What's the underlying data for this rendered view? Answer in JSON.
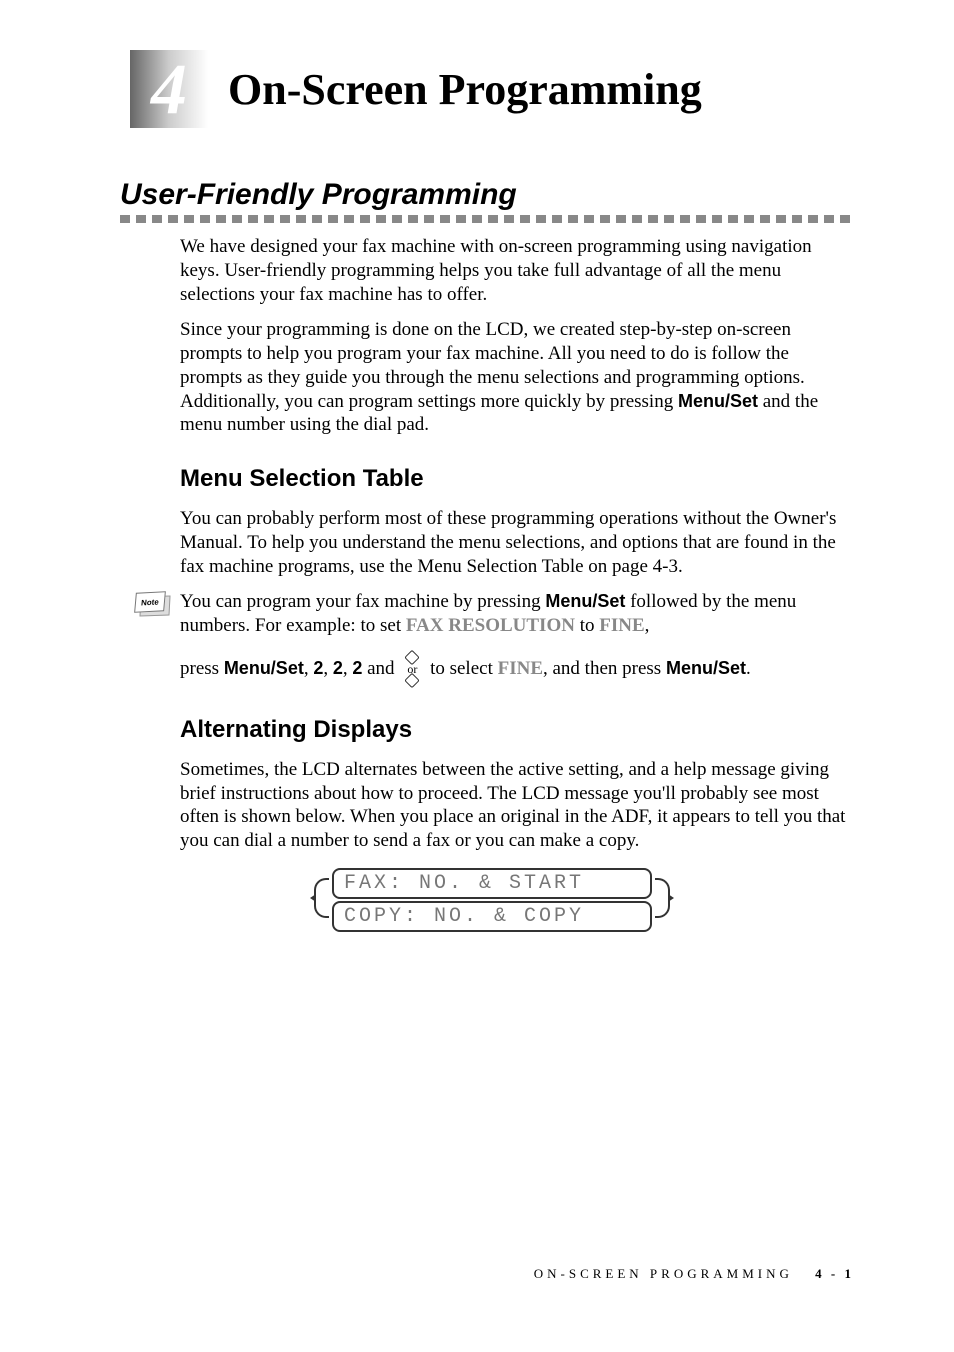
{
  "chapter": {
    "number": "4",
    "title": "On-Screen Programming"
  },
  "section1": {
    "title": "User-Friendly Programming",
    "para1": "We have designed your fax machine with on-screen programming using navigation keys. User-friendly programming helps you take full advantage of all the menu selections your fax machine has to offer.",
    "para2_pre": "Since your programming is done on the LCD, we created step-by-step on-screen prompts to help you program your fax machine. All you need to do is follow the prompts as they guide you through the menu selections and programming options. Additionally, you can program settings more quickly by pressing ",
    "para2_bold": "Menu/Set",
    "para2_post": " and the menu number using the dial pad."
  },
  "subsection1": {
    "title": "Menu Selection Table",
    "para1": "You can probably perform most of these programming operations without the Owner's Manual. To help you understand the menu selections, and options that are found in the fax machine programs, use the Menu Selection Table on page 4-3.",
    "note_label": "Note",
    "note_para_pre": "You can program your fax machine by pressing ",
    "note_menuset": "Menu/Set",
    "note_para_mid": " followed by the menu numbers. For example: to set ",
    "note_faxres": "FAX RESOLUTION",
    "note_to": " to ",
    "note_fine": "FINE",
    "note_comma": ",",
    "press_text": "press ",
    "press_menuset": "Menu/Set",
    "press_222": ", 2, 2, 2",
    "press_and": "  and  ",
    "or_label": "or",
    "press_select": "  to select ",
    "press_fine": "FINE",
    "press_then": ", and then press ",
    "press_menuset2": "Menu/Set",
    "press_period": "."
  },
  "subsection2": {
    "title": "Alternating Displays",
    "para1": "Sometimes, the LCD alternates between the active setting, and a help message giving brief instructions about how to proceed.  The LCD message you'll probably see most often is shown below. When you place an original in the ADF, it appears to tell you that you can dial a number to send a fax or you can make a copy.",
    "lcd_line1": "FAX: NO. & START",
    "lcd_line2": "COPY: NO. & COPY"
  },
  "footer": {
    "text": "ON-SCREEN PROGRAMMING",
    "page": "4 - 1"
  }
}
